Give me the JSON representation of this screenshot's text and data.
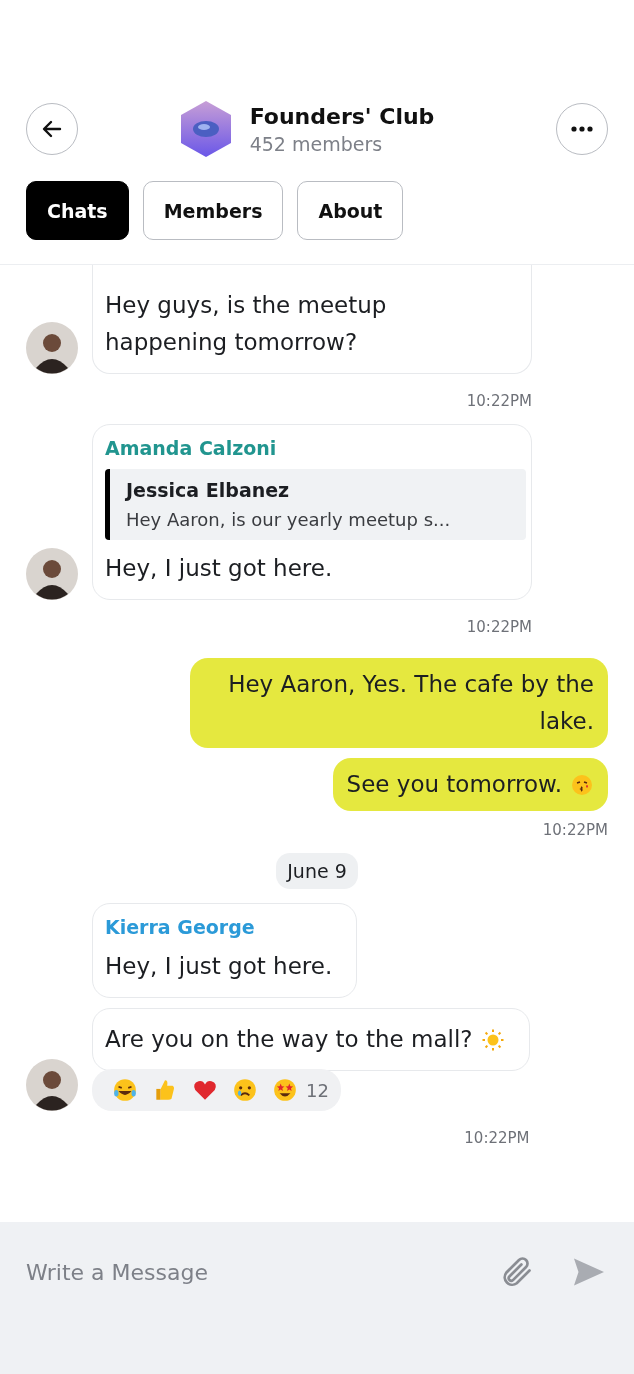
{
  "header": {
    "title": "Founders' Club",
    "subtitle": "452 members"
  },
  "tabs": [
    {
      "label": "Chats",
      "selected": true
    },
    {
      "label": "Members",
      "selected": false
    },
    {
      "label": "About",
      "selected": false
    }
  ],
  "feed": [
    {
      "kind": "incoming",
      "cut_top": true,
      "bubbles": [
        {
          "text": "Hey guys, is the meetup happening tomorrow?"
        }
      ],
      "time": "10:22PM"
    },
    {
      "kind": "incoming",
      "bubbles": [
        {
          "sender": "Amanda Calzoni",
          "color": "#21958f",
          "quote": {
            "author": "Jessica Elbanez",
            "text": "Hey Aaron, is our yearly meetup s..."
          },
          "text": "Hey, I just got here."
        }
      ],
      "time": "10:22PM"
    },
    {
      "kind": "outgoing",
      "bubbles": [
        {
          "text": "Hey Aaron, Yes. The cafe by the lake."
        },
        {
          "text": "See you tomorrow.",
          "trailing_icon": {
            "kind": "kiss"
          }
        }
      ],
      "time": "10:22PM"
    },
    {
      "kind": "date",
      "text": "June 9"
    },
    {
      "kind": "incoming",
      "bubbles": [
        {
          "sender": "Kierra George",
          "color": "#2b9ad8",
          "text": "Hey, I just got here."
        },
        {
          "text": "Are you on the way to the mall?",
          "trailing_icon": {
            "kind": "sun"
          },
          "reactions": {
            "emojis": [
              {
                "kind": "laugh"
              },
              {
                "kind": "thumbs"
              },
              {
                "kind": "heart"
              },
              {
                "kind": "cry"
              },
              {
                "kind": "stars"
              }
            ],
            "count": "12"
          }
        }
      ],
      "time": "10:22PM"
    }
  ],
  "composer": {
    "placeholder": "Write a Message"
  }
}
